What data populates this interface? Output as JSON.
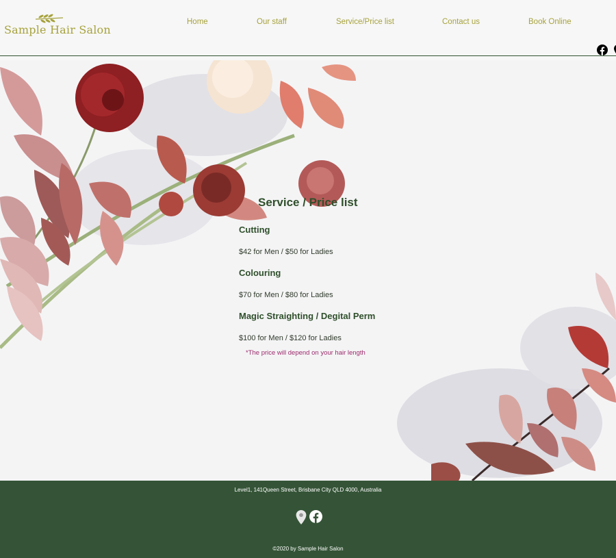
{
  "site": {
    "logo_text": "Sample Hair Salon",
    "logo_icon": "leaf-sprig-icon"
  },
  "nav": {
    "items": [
      {
        "label": "Home"
      },
      {
        "label": "Our staff"
      },
      {
        "label": "Service/Price list"
      },
      {
        "label": "Contact us"
      },
      {
        "label": "Book Online"
      }
    ]
  },
  "header_social": {
    "icons": [
      "facebook-icon",
      "location-pin-icon"
    ]
  },
  "main": {
    "title": "Service / Price list",
    "services": [
      {
        "name": "Cutting",
        "price": "$42 for Men / $50 for Ladies"
      },
      {
        "name": "Colouring",
        "price": "$70 for Men / $80 for Ladies"
      },
      {
        "name": "Magic Straighting / Degital Perm",
        "price": "$100 for Men / $120 for Ladies"
      }
    ],
    "note": "*The price will depend on your hair length"
  },
  "footer": {
    "address": "Level1, 141Queen Street, Brisbane City QLD 4000, Australia",
    "icons": [
      "location-pin-icon",
      "facebook-icon"
    ],
    "copyright": "©2020 by Sample Hair Salon"
  },
  "colors": {
    "accent_gold": "#a6a23c",
    "dark_green": "#2f4f2b",
    "footer_green": "#355437",
    "note_magenta": "#9c2b6b",
    "header_line": "#2f5130"
  }
}
